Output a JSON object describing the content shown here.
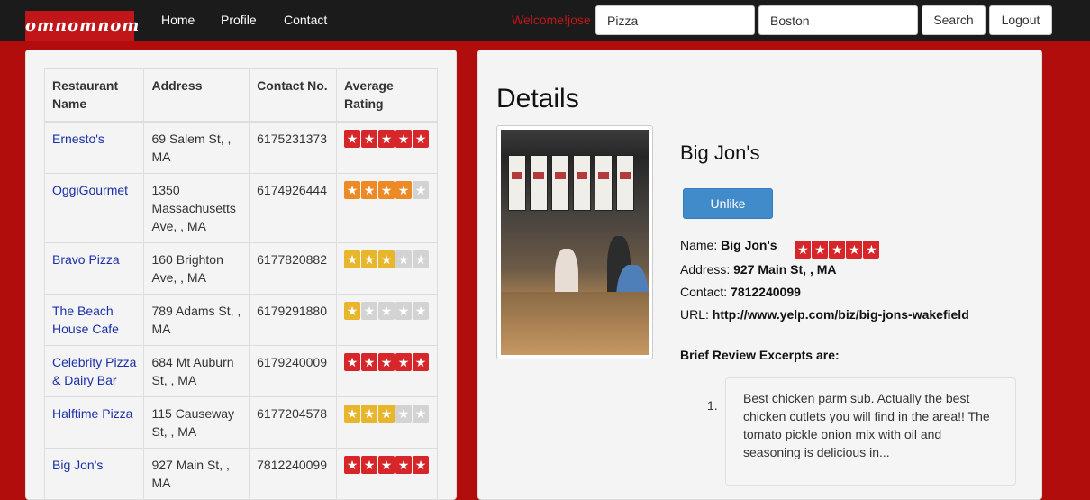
{
  "brand": {
    "logo_text": "omnomnom",
    "accent": "#c0161a",
    "background": "#b10d0d"
  },
  "nav": {
    "links": [
      "Home",
      "Profile",
      "Contact"
    ]
  },
  "user": {
    "welcome_text": "Welcome!jose"
  },
  "search": {
    "query_value": "Pizza",
    "location_value": "Boston",
    "search_label": "Search",
    "logout_label": "Logout"
  },
  "table": {
    "headers": [
      "Restaurant Name",
      "Address",
      "Contact No.",
      "Average Rating"
    ],
    "rows": [
      {
        "name": "Ernesto's",
        "address": "69 Salem St, , MA",
        "contact": "6175231373",
        "rating": 5,
        "star_color": "red"
      },
      {
        "name": "OggiGourmet",
        "address": "1350 Massachusetts Ave, , MA",
        "contact": "6174926444",
        "rating": 4,
        "star_color": "orange"
      },
      {
        "name": "Bravo Pizza",
        "address": "160 Brighton Ave, , MA",
        "contact": "6177820882",
        "rating": 3,
        "star_color": "gold"
      },
      {
        "name": "The Beach House Cafe",
        "address": "789 Adams St, , MA",
        "contact": "6179291880",
        "rating": 1,
        "star_color": "gold"
      },
      {
        "name": "Celebrity Pizza & Dairy Bar",
        "address": "684 Mt Auburn St, , MA",
        "contact": "6179240009",
        "rating": 5,
        "star_color": "red"
      },
      {
        "name": "Halftime Pizza",
        "address": "115 Causeway St, , MA",
        "contact": "6177204578",
        "rating": 3,
        "star_color": "gold"
      },
      {
        "name": "Big Jon's",
        "address": "927 Main St, , MA",
        "contact": "7812240099",
        "rating": 5,
        "star_color": "red"
      }
    ]
  },
  "details": {
    "title": "Details",
    "name": "Big Jon's",
    "unlike_label": "Unlike",
    "name_label": "Name:",
    "name_value": "Big Jon's",
    "rating": 5,
    "address_label": "Address:",
    "address_value": "927 Main St, , MA",
    "contact_label": "Contact:",
    "contact_value": "7812240099",
    "url_label": "URL:",
    "url_value": "http://www.yelp.com/biz/big-jons-wakefield",
    "excerpts_heading": "Brief Review Excerpts are:",
    "excerpts": [
      {
        "number": "1.",
        "text": "Best chicken parm sub. Actually the best chicken cutlets you will find in the area!! The tomato pickle onion mix with oil and seasoning is delicious in..."
      }
    ]
  }
}
